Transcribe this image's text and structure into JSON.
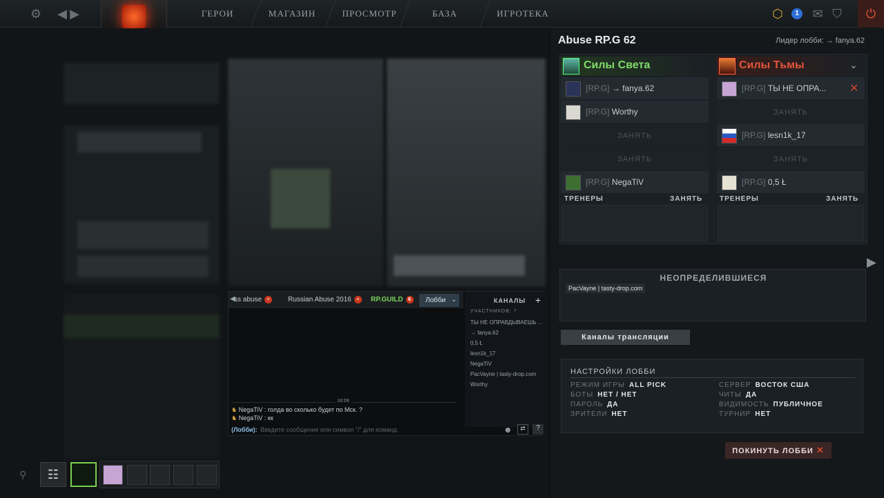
{
  "nav": {
    "heroes": "ГЕРОИ",
    "store": "МАГАЗИН",
    "watch": "ПРОСМОТР",
    "learn": "БАЗА ЗНАНИЙ",
    "arcade": "ИГРОТЕКА",
    "notification_count": "1"
  },
  "lobby": {
    "title": "Abuse RP.G 62",
    "leader": "Лидер лобби: → fanya.62",
    "radiant_title": "Силы Света",
    "dire_title": "Силы Тьмы",
    "take_label": "ЗАНЯТЬ",
    "coaches_label": "ТРЕНЕРЫ",
    "radiant_slots": [
      {
        "tag": "[RP.G]",
        "name": "→ fanya.62"
      },
      {
        "tag": "[RP.G]",
        "name": "Worthy"
      },
      {
        "tag": "",
        "name": ""
      },
      {
        "tag": "",
        "name": ""
      },
      {
        "tag": "[RP.G]",
        "name": "NegaTiV"
      }
    ],
    "dire_slots": [
      {
        "tag": "[RP.G]",
        "name": "ТЫ НЕ ОПРА..."
      },
      {
        "tag": "",
        "name": ""
      },
      {
        "tag": "[RP.G]",
        "name": "lesn1k_17"
      },
      {
        "tag": "",
        "name": ""
      },
      {
        "tag": "[RP.G]",
        "name": "0,5 Ł"
      }
    ],
    "unassigned_title": "НЕОПРЕДЕЛИВШИЕСЯ",
    "unassigned": [
      "PacVayne | tasty-drop.com"
    ],
    "broadcast_button": "Каналы трансляции",
    "settings_title": "НАСТРОЙКИ ЛОББИ",
    "settings_left": [
      {
        "label": "РЕЖИМ ИГРЫ",
        "value": "ALL PICK"
      },
      {
        "label": "БОТЫ",
        "value": "НЕТ / НЕТ"
      },
      {
        "label": "ПАРОЛЬ",
        "value": "ДА"
      },
      {
        "label": "ЗРИТЕЛИ",
        "value": "НЕТ"
      }
    ],
    "settings_right": [
      {
        "label": "СЕРВЕР",
        "value": "ВОСТОК США"
      },
      {
        "label": "ЧИТЫ",
        "value": "ДА"
      },
      {
        "label": "ВИДИМОСТЬ",
        "value": "ПУБЛИЧНОЕ"
      },
      {
        "label": "ТУРНИР",
        "value": "НЕТ"
      }
    ],
    "leave_button": "ПОКИНУТЬ ЛОББИ"
  },
  "chat": {
    "tabs": [
      {
        "label": "ss abuse",
        "badge": ""
      },
      {
        "label": "Russian Abuse 2016",
        "badge": ""
      },
      {
        "label": "RP.GUILD",
        "badge": "6"
      }
    ],
    "active_tab": "Лобби",
    "channels_label": "КАНАЛЫ",
    "members_label": "УЧАСТНИКОВ: 7",
    "members": [
      "ТЫ НЕ ОПРАВДЫВАЕШЬ ...",
      "→ fanya.62",
      "0,5 Ł",
      "lesn1k_17",
      "NegaTiV",
      "PacVayne | tasty-drop.com",
      "Worthy"
    ],
    "time": "18:09",
    "messages": [
      {
        "author": "NegaTiV",
        "text": ": голда во сколько будет по Мск. ?"
      },
      {
        "author": "NegaTiV",
        "text": ": кк"
      }
    ],
    "input_prefix": "(Лобби):",
    "input_placeholder": "Введите сообщение или символ \"/\" для команд."
  },
  "colors": {
    "radiant": "#7fdc6a",
    "dire": "#e2543b",
    "accent": "#c33a2a"
  }
}
